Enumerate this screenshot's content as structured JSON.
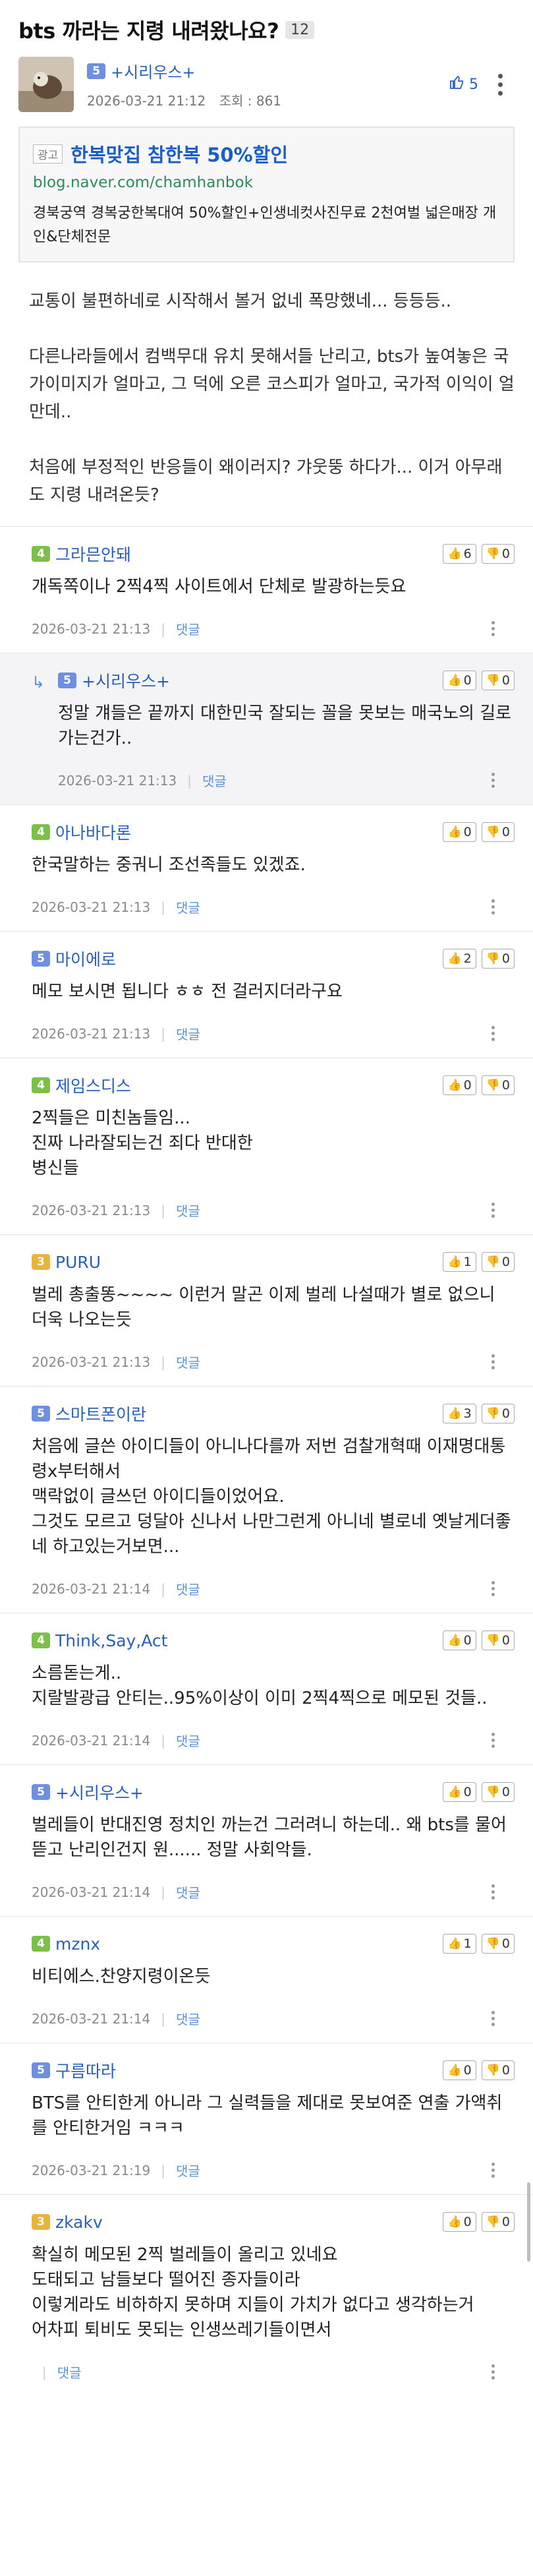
{
  "post": {
    "title": "bts 까라는 지령 내려왔나요?",
    "comment_count": "12",
    "author": {
      "level": "5",
      "level_color": "#6f8fe0",
      "name": "+시리우스+"
    },
    "datetime": "2026-03-21 21:12",
    "views": "조회 : 861",
    "likes": "5",
    "icons": {
      "like": "thumbs-up-icon",
      "more": "vertical-dots-icon"
    }
  },
  "ad": {
    "tag": "광고",
    "title": "한복맞집 참한복 50%할인",
    "url": "blog.naver.com/chamhanbok",
    "description": "경북궁역 경복궁한복대여 50%할인+인생네컷사진무료 2천여벌 넓은매장 개인&단체전문"
  },
  "body": [
    "교통이 불편하네로 시작해서 볼거 없네 폭망했네... 등등등..",
    "다른나라들에서 컴백무대 유치 못해서들 난리고, bts가 높여놓은 국가이미지가 얼마고, 그 덕에 오른 코스피가 얼마고, 국가적 이익이 얼만데..",
    "처음에 부정적인 반응들이 왜이러지? 갸웃뚱 하다가... 이거 아무래도 지령 내려온듯?"
  ],
  "reply_label": "댓글",
  "comments": [
    {
      "level": "4",
      "level_color": "#7cbf4a",
      "name": "그라믄안돼",
      "up": "6",
      "down": "0",
      "reply": false,
      "lines": [
        "개독쪽이나 2찍4찍 사이트에서 단체로 발광하는듯요"
      ],
      "time": "2026-03-21 21:13"
    },
    {
      "level": "5",
      "level_color": "#6f8fe0",
      "name": "+시리우스+",
      "up": "0",
      "down": "0",
      "reply": true,
      "lines": [
        "정말 걔들은 끝까지 대한민국 잘되는 꼴을 못보는 매국노의 길로 가는건가.."
      ],
      "time": "2026-03-21 21:13"
    },
    {
      "level": "4",
      "level_color": "#7cbf4a",
      "name": "아나바다론",
      "up": "0",
      "down": "0",
      "reply": false,
      "lines": [
        "한국말하는 중궈니 조선족들도 있겠죠."
      ],
      "time": "2026-03-21 21:13"
    },
    {
      "level": "5",
      "level_color": "#6f8fe0",
      "name": "마이에로",
      "up": "2",
      "down": "0",
      "reply": false,
      "lines": [
        "메모 보시면 됩니다 ㅎㅎ 전 걸러지더라구요"
      ],
      "time": "2026-03-21 21:13"
    },
    {
      "level": "4",
      "level_color": "#7cbf4a",
      "name": "제임스디스",
      "up": "0",
      "down": "0",
      "reply": false,
      "lines": [
        "2찍들은 미친놈들임...",
        "진짜 나라잘되는건 죄다 반대한",
        "병신들"
      ],
      "time": "2026-03-21 21:13"
    },
    {
      "level": "3",
      "level_color": "#e8b43a",
      "name": "PURU",
      "up": "1",
      "down": "0",
      "reply": false,
      "lines": [
        "벌레 총출똥~~~~ 이런거 말곤 이제 벌레 나설때가 별로 없으니 더욱 나오는듯"
      ],
      "time": "2026-03-21 21:13"
    },
    {
      "level": "5",
      "level_color": "#6f8fe0",
      "name": "스마트폰이란",
      "up": "3",
      "down": "0",
      "reply": false,
      "lines": [
        "처음에 글쓴 아이디들이 아니나다를까 저번 검찰개혁때 이재명대통령x부터해서",
        "맥락없이 글쓰던 아이디들이었어요.",
        "그것도 모르고 덩달아 신나서 나만그런게 아니네 별로네 옛날게더좋네 하고있는거보면..."
      ],
      "time": "2026-03-21 21:14"
    },
    {
      "level": "4",
      "level_color": "#7cbf4a",
      "name": "Think,Say,Act",
      "up": "0",
      "down": "0",
      "reply": false,
      "lines": [
        "소름돋는게..",
        "지랄발광급 안티는..95%이상이 이미 2찍4찍으로 메모된 것들.."
      ],
      "time": "2026-03-21 21:14"
    },
    {
      "level": "5",
      "level_color": "#6f8fe0",
      "name": "+시리우스+",
      "up": "0",
      "down": "0",
      "reply": false,
      "lines": [
        "벌레들이 반대진영 정치인 까는건 그러려니 하는데.. 왜 bts를 물어뜯고 난리인건지 원...... 정말 사회악들."
      ],
      "time": "2026-03-21 21:14"
    },
    {
      "level": "4",
      "level_color": "#7cbf4a",
      "name": "mznx",
      "up": "1",
      "down": "0",
      "reply": false,
      "lines": [
        "비티에스.찬양지령이온듯"
      ],
      "time": "2026-03-21 21:14"
    },
    {
      "level": "5",
      "level_color": "#6f8fe0",
      "name": "구름따라",
      "up": "0",
      "down": "0",
      "reply": false,
      "lines": [
        "BTS를 안티한게 아니라 그 실력들을 제대로 못보여준 연출 가액취를 안티한거임 ㅋㅋㅋ"
      ],
      "time": "2026-03-21 21:19"
    },
    {
      "level": "3",
      "level_color": "#e8b43a",
      "name": "zkakv",
      "up": "0",
      "down": "0",
      "reply": false,
      "lines": [
        "확실히 메모된 2찍 벌레들이 올리고 있네요",
        "도태되고 남들보다 떨어진 종자들이라",
        "이렇게라도 비하하지 못하며 지들이 가치가 없다고 생각하는거",
        "어차피 퇴비도 못되는 인생쓰레기들이면서"
      ],
      "time": ""
    }
  ],
  "icons": {
    "reply_arrow": "reply-arrow-icon",
    "vote_up": "thumbs-up-icon",
    "vote_down": "thumbs-down-icon"
  }
}
